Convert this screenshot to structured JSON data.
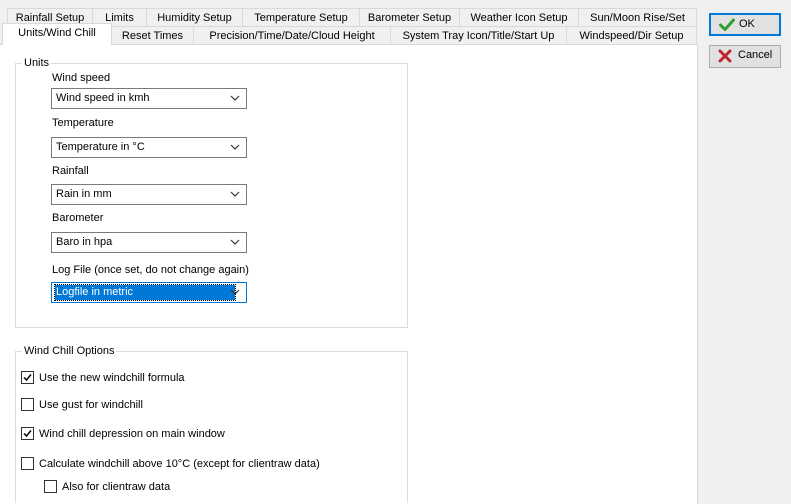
{
  "tabs": {
    "row1": [
      {
        "label": "Rainfall Setup"
      },
      {
        "label": "Limits"
      },
      {
        "label": "Humidity Setup"
      },
      {
        "label": "Temperature Setup"
      },
      {
        "label": "Barometer Setup"
      },
      {
        "label": "Weather Icon Setup"
      },
      {
        "label": "Sun/Moon Rise/Set"
      }
    ],
    "row2": [
      {
        "label": "Units/Wind Chill",
        "active": true
      },
      {
        "label": "Reset Times"
      },
      {
        "label": "Precision/Time/Date/Cloud Height"
      },
      {
        "label": "System Tray Icon/Title/Start Up"
      },
      {
        "label": "Windspeed/Dir Setup"
      }
    ]
  },
  "units": {
    "title": "Units",
    "wind_speed": {
      "label": "Wind speed",
      "value": "Wind speed in kmh"
    },
    "temperature": {
      "label": "Temperature",
      "value": "Temperature in °C"
    },
    "rainfall": {
      "label": "Rainfall",
      "value": "Rain in mm"
    },
    "barometer": {
      "label": "Barometer",
      "value": "Baro in hpa"
    },
    "log_file": {
      "label": "Log File (once set, do not change again)",
      "value": "Logfile in metric",
      "focused": true
    }
  },
  "wind_chill": {
    "title": "Wind Chill Options",
    "new_formula": {
      "label": "Use the new windchill formula",
      "checked": true
    },
    "use_gust": {
      "label": "Use gust for windchill",
      "checked": false
    },
    "depression": {
      "label": "Wind chill depression on main window",
      "checked": true
    },
    "above_10": {
      "label": "Calculate windchill above 10°C (except for clientraw data)",
      "checked": false
    },
    "clientraw": {
      "label": "Also for clientraw data",
      "checked": false
    }
  },
  "buttons": {
    "ok": {
      "label": "OK",
      "icon": "check-icon"
    },
    "cancel": {
      "label": "Cancel",
      "icon": "x-icon"
    }
  },
  "colors": {
    "accent": "#0078d7",
    "ok_check": "#2e9e2e",
    "cancel_x": "#c0262c"
  }
}
